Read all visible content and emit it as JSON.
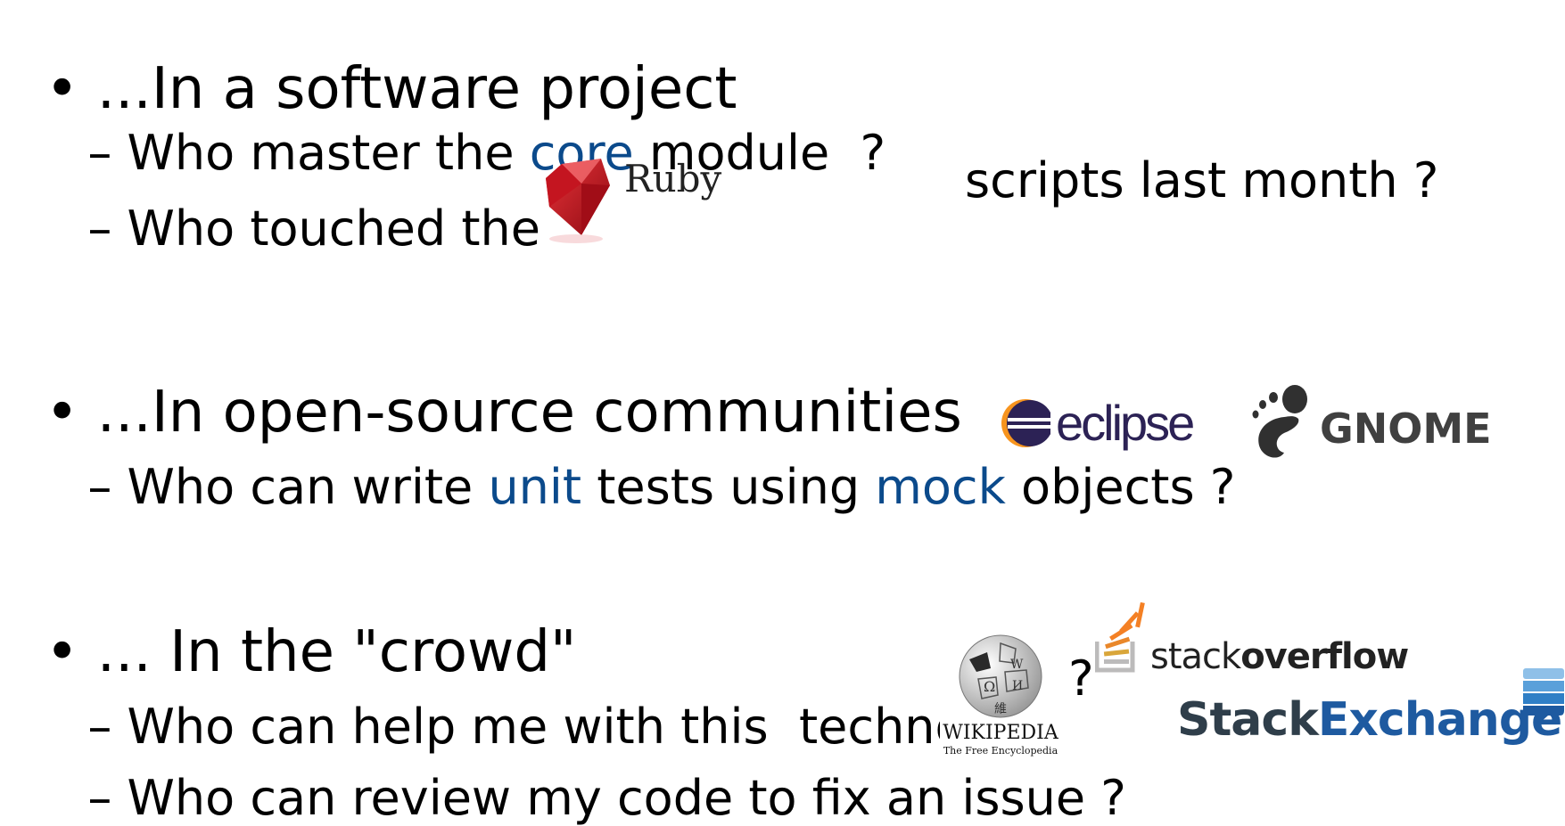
{
  "slide": {
    "sections": [
      {
        "bullet": "•",
        "heading": "...In a software project",
        "items": [
          {
            "dash": "–",
            "pre": "Who master the ",
            "highlight": "core",
            "post": " module  ?"
          },
          {
            "dash": "–",
            "pre": "Who touched the ",
            "post": "scripts last month ?"
          }
        ]
      },
      {
        "bullet": "•",
        "heading": "...In open-source communities",
        "items": [
          {
            "dash": "–",
            "pre": "Who can write ",
            "h1": "unit",
            "mid": " tests using ",
            "h2": "mock",
            "post": " objects ?"
          }
        ]
      },
      {
        "bullet": "•",
        "heading": "... In the \"crowd\"",
        "items": [
          {
            "dash": "–",
            "pre": "Who can help me with this  techno",
            "post": "?"
          },
          {
            "dash": "–",
            "pre": "Who can review my code to fix an issue ?"
          }
        ]
      }
    ]
  },
  "logos": {
    "ruby": {
      "name": "Ruby",
      "icon": "ruby-gem-icon",
      "color": "#c8101e"
    },
    "eclipse": {
      "name": "eclipse",
      "icon": "eclipse-icon",
      "color": "#2c2255"
    },
    "gnome": {
      "name": "GNOME",
      "icon": "gnome-foot-icon",
      "color": "#404040"
    },
    "wikipedia": {
      "name": "WIKIPEDIA",
      "tagline": "The Free Encyclopedia",
      "icon": "wikipedia-globe-icon"
    },
    "stackoverflow": {
      "name_light": "stack",
      "name_bold": "overflow",
      "icon": "stackoverflow-icon",
      "color": "#f48024"
    },
    "stackexchange": {
      "name_dark": "Stack",
      "name_blue": "Exchange",
      "icon": "stackexchange-icon",
      "color": "#1e5aa0"
    }
  },
  "colors": {
    "highlight": "#0b4a8b",
    "text": "#000000"
  }
}
